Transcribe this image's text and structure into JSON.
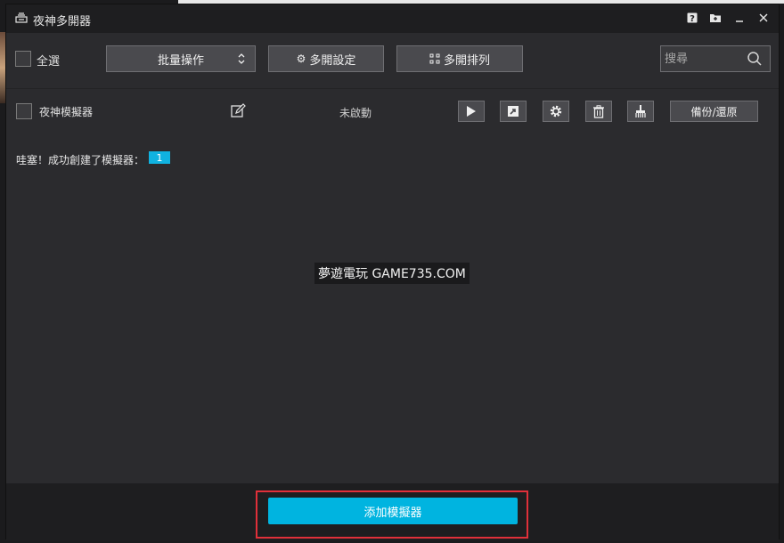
{
  "window": {
    "title": "夜神多開器",
    "title_icon": "multi-drive-icon",
    "controls": [
      "help-icon",
      "folder-icon",
      "minimize-icon",
      "close-icon"
    ]
  },
  "toolbar": {
    "select_all_label": "全選",
    "batch_label": "批量操作",
    "multi_settings_label": "多開設定",
    "multi_arrange_label": "多開排列",
    "search_placeholder": "搜尋"
  },
  "emulator": {
    "name": "夜神模擬器",
    "status": "未啟動",
    "backup_label": "備份/還原",
    "actions": [
      "play-icon",
      "shortcut-icon",
      "gear-icon",
      "trash-icon",
      "broom-icon"
    ]
  },
  "message": {
    "success_text": "哇塞！成功創建了模擬器：",
    "count": "1"
  },
  "watermark": "夢遊電玩 GAME735.COM",
  "footer": {
    "add_label": "添加模擬器"
  },
  "colors": {
    "accent": "#00b4e0",
    "highlight": "#e0303a",
    "background": "#2b2b2e",
    "titlebar": "#1e1e20"
  }
}
